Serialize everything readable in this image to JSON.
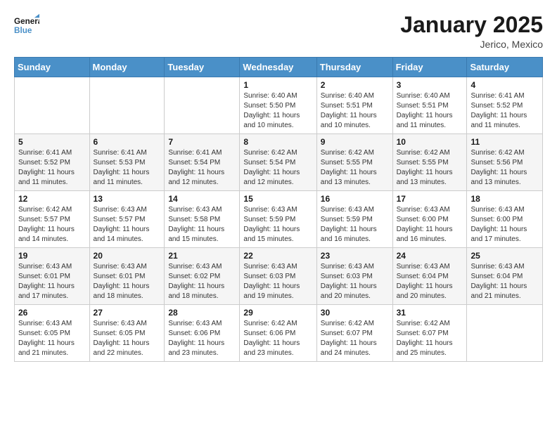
{
  "header": {
    "logo_line1": "General",
    "logo_line2": "Blue",
    "month_title": "January 2025",
    "location": "Jerico, Mexico"
  },
  "weekdays": [
    "Sunday",
    "Monday",
    "Tuesday",
    "Wednesday",
    "Thursday",
    "Friday",
    "Saturday"
  ],
  "weeks": [
    [
      {
        "day": "",
        "info": ""
      },
      {
        "day": "",
        "info": ""
      },
      {
        "day": "",
        "info": ""
      },
      {
        "day": "1",
        "info": "Sunrise: 6:40 AM\nSunset: 5:50 PM\nDaylight: 11 hours and 10 minutes."
      },
      {
        "day": "2",
        "info": "Sunrise: 6:40 AM\nSunset: 5:51 PM\nDaylight: 11 hours and 10 minutes."
      },
      {
        "day": "3",
        "info": "Sunrise: 6:40 AM\nSunset: 5:51 PM\nDaylight: 11 hours and 11 minutes."
      },
      {
        "day": "4",
        "info": "Sunrise: 6:41 AM\nSunset: 5:52 PM\nDaylight: 11 hours and 11 minutes."
      }
    ],
    [
      {
        "day": "5",
        "info": "Sunrise: 6:41 AM\nSunset: 5:52 PM\nDaylight: 11 hours and 11 minutes."
      },
      {
        "day": "6",
        "info": "Sunrise: 6:41 AM\nSunset: 5:53 PM\nDaylight: 11 hours and 11 minutes."
      },
      {
        "day": "7",
        "info": "Sunrise: 6:41 AM\nSunset: 5:54 PM\nDaylight: 11 hours and 12 minutes."
      },
      {
        "day": "8",
        "info": "Sunrise: 6:42 AM\nSunset: 5:54 PM\nDaylight: 11 hours and 12 minutes."
      },
      {
        "day": "9",
        "info": "Sunrise: 6:42 AM\nSunset: 5:55 PM\nDaylight: 11 hours and 13 minutes."
      },
      {
        "day": "10",
        "info": "Sunrise: 6:42 AM\nSunset: 5:55 PM\nDaylight: 11 hours and 13 minutes."
      },
      {
        "day": "11",
        "info": "Sunrise: 6:42 AM\nSunset: 5:56 PM\nDaylight: 11 hours and 13 minutes."
      }
    ],
    [
      {
        "day": "12",
        "info": "Sunrise: 6:42 AM\nSunset: 5:57 PM\nDaylight: 11 hours and 14 minutes."
      },
      {
        "day": "13",
        "info": "Sunrise: 6:43 AM\nSunset: 5:57 PM\nDaylight: 11 hours and 14 minutes."
      },
      {
        "day": "14",
        "info": "Sunrise: 6:43 AM\nSunset: 5:58 PM\nDaylight: 11 hours and 15 minutes."
      },
      {
        "day": "15",
        "info": "Sunrise: 6:43 AM\nSunset: 5:59 PM\nDaylight: 11 hours and 15 minutes."
      },
      {
        "day": "16",
        "info": "Sunrise: 6:43 AM\nSunset: 5:59 PM\nDaylight: 11 hours and 16 minutes."
      },
      {
        "day": "17",
        "info": "Sunrise: 6:43 AM\nSunset: 6:00 PM\nDaylight: 11 hours and 16 minutes."
      },
      {
        "day": "18",
        "info": "Sunrise: 6:43 AM\nSunset: 6:00 PM\nDaylight: 11 hours and 17 minutes."
      }
    ],
    [
      {
        "day": "19",
        "info": "Sunrise: 6:43 AM\nSunset: 6:01 PM\nDaylight: 11 hours and 17 minutes."
      },
      {
        "day": "20",
        "info": "Sunrise: 6:43 AM\nSunset: 6:01 PM\nDaylight: 11 hours and 18 minutes."
      },
      {
        "day": "21",
        "info": "Sunrise: 6:43 AM\nSunset: 6:02 PM\nDaylight: 11 hours and 18 minutes."
      },
      {
        "day": "22",
        "info": "Sunrise: 6:43 AM\nSunset: 6:03 PM\nDaylight: 11 hours and 19 minutes."
      },
      {
        "day": "23",
        "info": "Sunrise: 6:43 AM\nSunset: 6:03 PM\nDaylight: 11 hours and 20 minutes."
      },
      {
        "day": "24",
        "info": "Sunrise: 6:43 AM\nSunset: 6:04 PM\nDaylight: 11 hours and 20 minutes."
      },
      {
        "day": "25",
        "info": "Sunrise: 6:43 AM\nSunset: 6:04 PM\nDaylight: 11 hours and 21 minutes."
      }
    ],
    [
      {
        "day": "26",
        "info": "Sunrise: 6:43 AM\nSunset: 6:05 PM\nDaylight: 11 hours and 21 minutes."
      },
      {
        "day": "27",
        "info": "Sunrise: 6:43 AM\nSunset: 6:05 PM\nDaylight: 11 hours and 22 minutes."
      },
      {
        "day": "28",
        "info": "Sunrise: 6:43 AM\nSunset: 6:06 PM\nDaylight: 11 hours and 23 minutes."
      },
      {
        "day": "29",
        "info": "Sunrise: 6:42 AM\nSunset: 6:06 PM\nDaylight: 11 hours and 23 minutes."
      },
      {
        "day": "30",
        "info": "Sunrise: 6:42 AM\nSunset: 6:07 PM\nDaylight: 11 hours and 24 minutes."
      },
      {
        "day": "31",
        "info": "Sunrise: 6:42 AM\nSunset: 6:07 PM\nDaylight: 11 hours and 25 minutes."
      },
      {
        "day": "",
        "info": ""
      }
    ]
  ]
}
